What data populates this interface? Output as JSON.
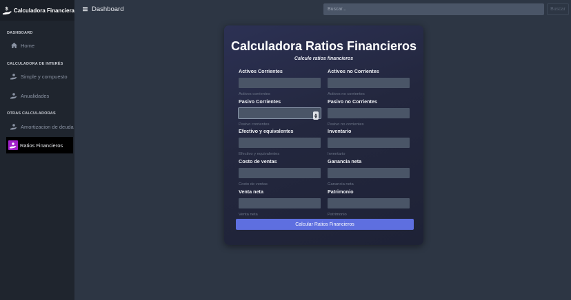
{
  "brand": {
    "name": "Calculadora Financiera",
    "logo_icon": "money-hand-icon"
  },
  "sidebar": {
    "sections": [
      {
        "heading": "DASHBOARD"
      },
      {
        "heading": "CALCULADORA DE INTERÉS"
      },
      {
        "heading": "OTRAS CALCULADORAS"
      }
    ],
    "items": [
      {
        "label": "Home",
        "icon": "home-icon"
      },
      {
        "label": "Simple y compuesto",
        "icon": "hand-coin-icon"
      },
      {
        "label": "Anualidades",
        "icon": "hand-coin-icon"
      },
      {
        "label": "Amortizacion de deuda",
        "icon": "hand-coin-icon"
      },
      {
        "label": "Ratios Financieros",
        "icon": "hand-coin-icon",
        "active": true
      }
    ]
  },
  "topbar": {
    "menu_icon": "hamburger-icon",
    "title": "Dashboard",
    "search_placeholder": "Buscar...",
    "search_button": "Buscar"
  },
  "form": {
    "title": "Calculadora Ratios Financieros",
    "subtitle": "Calcule ratios financieros",
    "fields": [
      {
        "label": "Activos Corrientes",
        "hint": "Activos corrientes",
        "value": ""
      },
      {
        "label": "Activos no Corrientes",
        "hint": "Activos no corrientes",
        "value": ""
      },
      {
        "label": "Pasivo Corrientes",
        "hint": "Pasivo corrientes",
        "value": ""
      },
      {
        "label": "Pasivo no Corrientes",
        "hint": "Pasivo no corrientes",
        "value": ""
      },
      {
        "label": "Efectivo y equivalentes",
        "hint": "Efectivo y equivalentes",
        "value": ""
      },
      {
        "label": "Inventario",
        "hint": "Inventario",
        "value": ""
      },
      {
        "label": "Costo de ventas",
        "hint": "Costo de ventas",
        "value": ""
      },
      {
        "label": "Ganancia neta",
        "hint": "Ganancia neta",
        "value": ""
      },
      {
        "label": "Venta neta",
        "hint": "Venta neta",
        "value": ""
      },
      {
        "label": "Patrimonio",
        "hint": "Patrimonio",
        "value": ""
      }
    ],
    "submit_label": "Calcular Ratios Financieros"
  },
  "colors": {
    "accent": "#5e6fe0",
    "active_icon_bg": "#a020c8",
    "sidebar_bg": "#1f252e",
    "page_bg": "#2d3644",
    "input_bg": "#4a5567"
  }
}
